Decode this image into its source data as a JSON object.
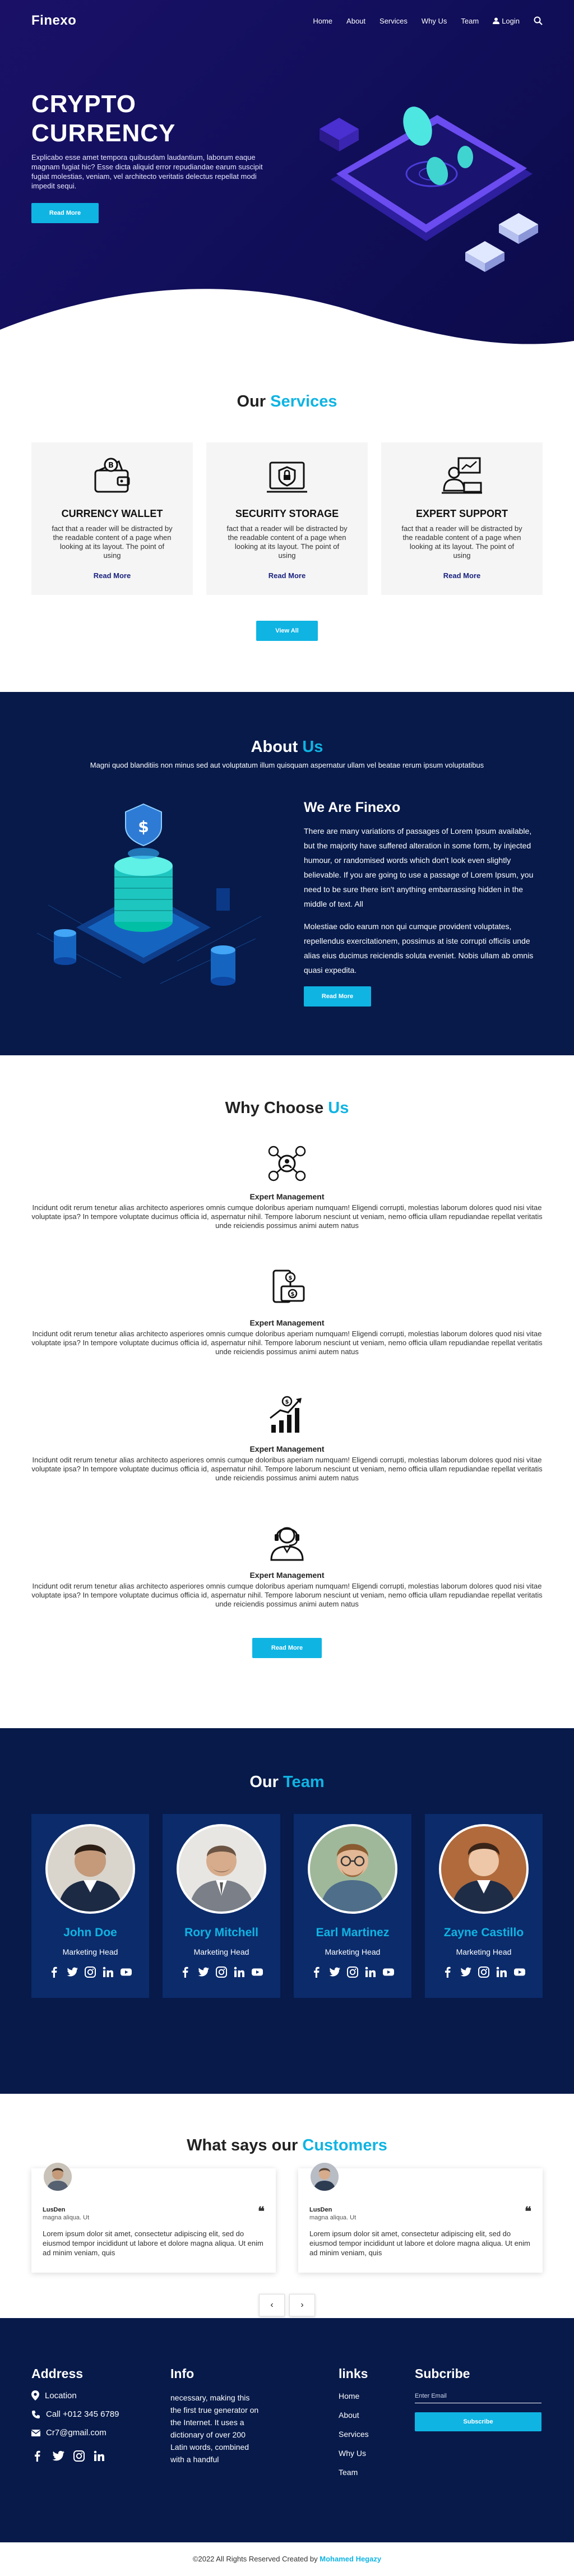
{
  "nav": {
    "logo": "Finexo",
    "items": [
      "Home",
      "About",
      "Services",
      "Why Us",
      "Team"
    ],
    "login": "Login"
  },
  "hero": {
    "title_line1": "CRYPTO",
    "title_line2": "CURRENCY",
    "text": "Explicabo esse amet tempora quibusdam laudantium, laborum eaque magnam fugiat hic? Esse dicta aliquid error repudiandae earum suscipit fugiat molestias, veniam, vel architecto veritatis delectus repellat modi impedit sequi.",
    "button": "Read More"
  },
  "services": {
    "title_main": "Our ",
    "title_accent": "Services",
    "items": [
      {
        "title": "CURRENCY WALLET",
        "text": "fact that a reader will be distracted by the readable content of a page when looking at its layout. The point of using",
        "link": "Read More"
      },
      {
        "title": "SECURITY STORAGE",
        "text": "fact that a reader will be distracted by the readable content of a page when looking at its layout. The point of using",
        "link": "Read More"
      },
      {
        "title": "EXPERT SUPPORT",
        "text": "fact that a reader will be distracted by the readable content of a page when looking at its layout. The point of using",
        "link": "Read More"
      }
    ],
    "button": "View All"
  },
  "about": {
    "title_main": "About ",
    "title_accent": "Us",
    "subtitle": "Magni quod blanditiis non minus sed aut voluptatum illum quisquam aspernatur ullam vel beatae rerum ipsum voluptatibus",
    "heading": "We Are Finexo",
    "p1": "There are many variations of passages of Lorem Ipsum available, but the majority have suffered alteration in some form, by injected humour, or randomised words which don't look even slightly believable. If you are going to use a passage of Lorem Ipsum, you need to be sure there isn't anything embarrassing hidden in the middle of text. All",
    "p2": "Molestiae odio earum non qui cumque provident voluptates, repellendus exercitationem, possimus at iste corrupti officiis unde alias eius ducimus reiciendis soluta eveniet. Nobis ullam ab omnis quasi expedita.",
    "button": "Read More"
  },
  "why": {
    "title_main": "Why Choose ",
    "title_accent": "Us",
    "items": [
      {
        "icon": "management-icon",
        "title": "Expert Management",
        "text": "Incidunt odit rerum tenetur alias architecto asperiores omnis cumque doloribus aperiam numquam! Eligendi corrupti, molestias laborum dolores quod nisi vitae voluptate ipsa? In tempore voluptate ducimus officia id, aspernatur nihil. Tempore laborum nesciunt ut veniam, nemo officia ullam repudiandae repellat veritatis unde reiciendis possimus animi autem natus"
      },
      {
        "icon": "investment-icon",
        "title": "Expert Management",
        "text": "Incidunt odit rerum tenetur alias architecto asperiores omnis cumque doloribus aperiam numquam! Eligendi corrupti, molestias laborum dolores quod nisi vitae voluptate ipsa? In tempore voluptate ducimus officia id, aspernatur nihil. Tempore laborum nesciunt ut veniam, nemo officia ullam repudiandae repellat veritatis unde reiciendis possimus animi autem natus"
      },
      {
        "icon": "growth-chart-icon",
        "title": "Expert Management",
        "text": "Incidunt odit rerum tenetur alias architecto asperiores omnis cumque doloribus aperiam numquam! Eligendi corrupti, molestias laborum dolores quod nisi vitae voluptate ipsa? In tempore voluptate ducimus officia id, aspernatur nihil. Tempore laborum nesciunt ut veniam, nemo officia ullam repudiandae repellat veritatis unde reiciendis possimus animi autem natus"
      },
      {
        "icon": "support-agent-icon",
        "title": "Expert Management",
        "text": "Incidunt odit rerum tenetur alias architecto asperiores omnis cumque doloribus aperiam numquam! Eligendi corrupti, molestias laborum dolores quod nisi vitae voluptate ipsa? In tempore voluptate ducimus officia id, aspernatur nihil. Tempore laborum nesciunt ut veniam, nemo officia ullam repudiandae repellat veritatis unde reiciendis possimus animi autem natus"
      }
    ],
    "button": "Read More"
  },
  "team": {
    "title_main": "Our ",
    "title_accent": "Team",
    "members": [
      {
        "name": "John Doe",
        "role": "Marketing Head"
      },
      {
        "name": "Rory Mitchell",
        "role": "Marketing Head"
      },
      {
        "name": "Earl Martinez",
        "role": "Marketing Head"
      },
      {
        "name": "Zayne Castillo",
        "role": "Marketing Head"
      }
    ]
  },
  "testimonials": {
    "title_main": "What says our ",
    "title_accent": "Customers",
    "items": [
      {
        "name": "LusDen",
        "job": "magna aliqua. Ut",
        "text": "Lorem ipsum dolor sit amet, consectetur adipiscing elit, sed do eiusmod tempor incididunt ut labore et dolore magna aliqua. Ut enim ad minim veniam, quis"
      },
      {
        "name": "LusDen",
        "job": "magna aliqua. Ut",
        "text": "Lorem ipsum dolor sit amet, consectetur adipiscing elit, sed do eiusmod tempor incididunt ut labore et dolore magna aliqua. Ut enim ad minim veniam, quis"
      }
    ],
    "prev": "‹",
    "next": "›"
  },
  "footer": {
    "address_title": "Address",
    "location": "Location",
    "phone": "Call +012 345 6789",
    "email": "Cr7@gmail.com",
    "info_title": "Info",
    "info_text": "necessary, making this the first true generator on the Internet. It uses a dictionary of over 200 Latin words, combined with a handful",
    "links_title": "links",
    "links": [
      "Home",
      "About",
      "Services",
      "Why Us",
      "Team"
    ],
    "subscribe_title": "Subcribe",
    "email_placeholder": "Enter Email",
    "subscribe_button": "Subscribe"
  },
  "copyright": {
    "text": "©2022 All Rights Reserved Created by ",
    "author": "Mohamed Hegazy"
  },
  "colors": {
    "accent": "#0fb4e3",
    "hero_bg": "#1a1167",
    "dark_bg": "#071a4a",
    "card_bg": "#0b2b6b"
  }
}
